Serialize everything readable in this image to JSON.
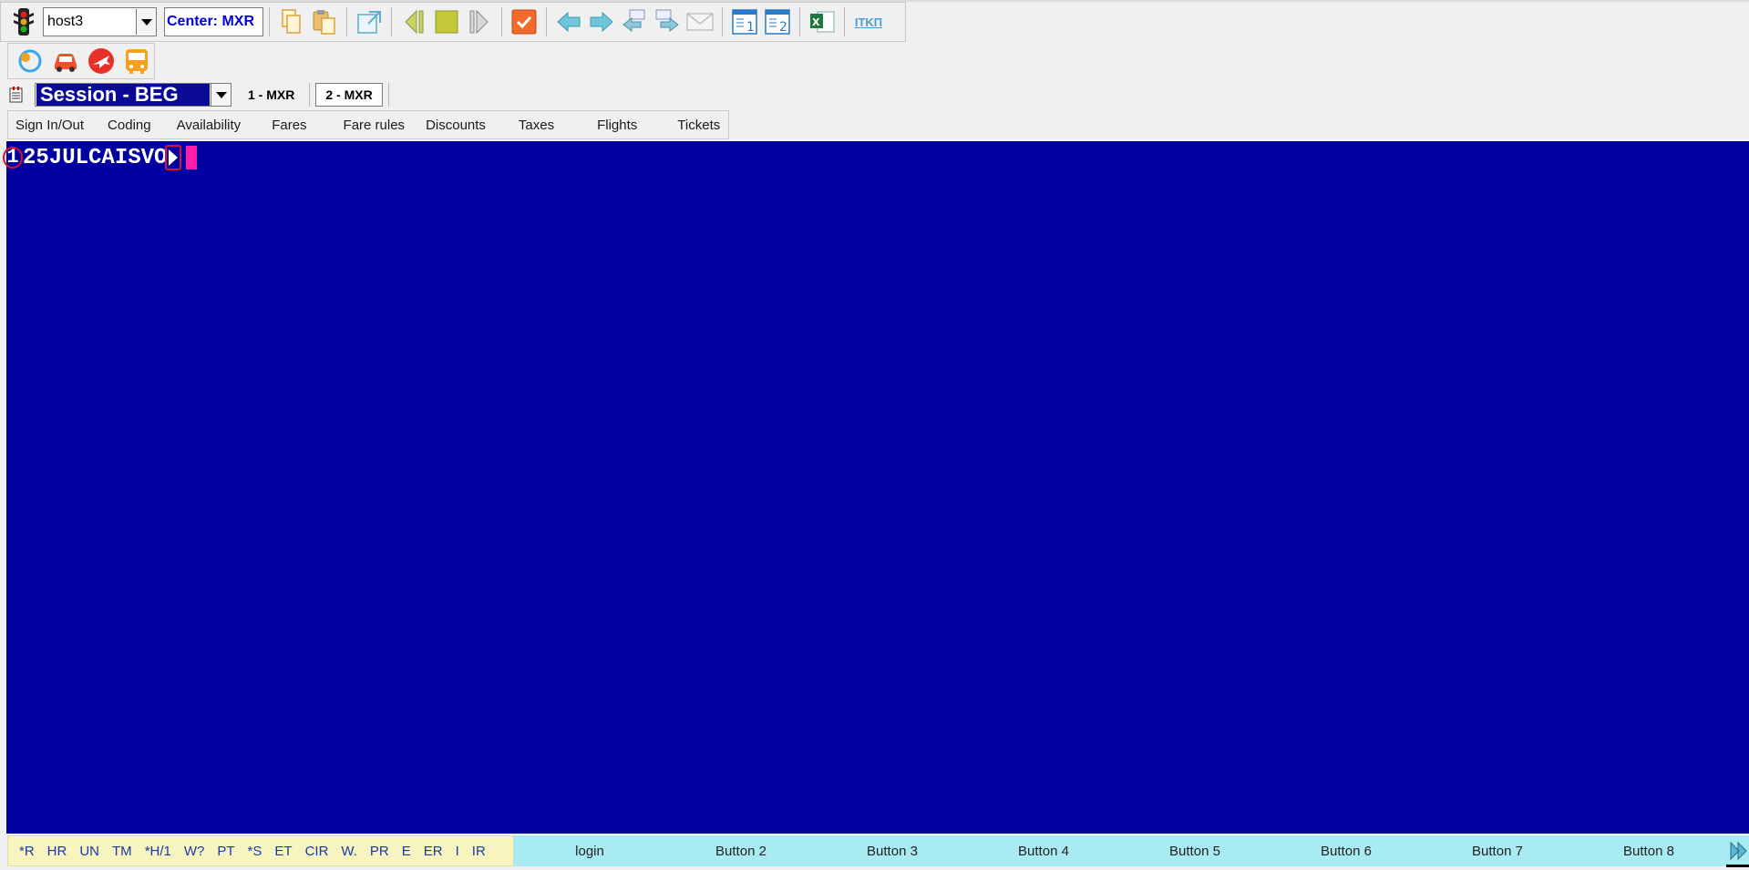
{
  "toolbar": {
    "host_value": "host3",
    "center_label": "Center: MXR",
    "itkp_label": "ITKП"
  },
  "session": {
    "current": "Session - BEG",
    "tabs": [
      "1 - MXR",
      "2 - MXR"
    ]
  },
  "menu": {
    "items": [
      "Sign In/Out",
      "Coding",
      "Availability",
      "Fares",
      "Fare rules",
      "Discounts",
      "Taxes",
      "Flights",
      "Tickets"
    ]
  },
  "terminal": {
    "line_number": "1",
    "command": "25JULCAISVO",
    "bg_color": "#0000a0",
    "cursor_color": "#ff1ea8"
  },
  "quick_keys": [
    "*R",
    "HR",
    "UN",
    "TM",
    "*H/1",
    "W?",
    "PT",
    "*S",
    "ET",
    "CIR",
    "W.",
    "PR",
    "E",
    "ER",
    "I",
    "IR"
  ],
  "buttons": [
    "login",
    "Button 2",
    "Button 3",
    "Button 4",
    "Button 5",
    "Button 6",
    "Button 7",
    "Button 8"
  ]
}
